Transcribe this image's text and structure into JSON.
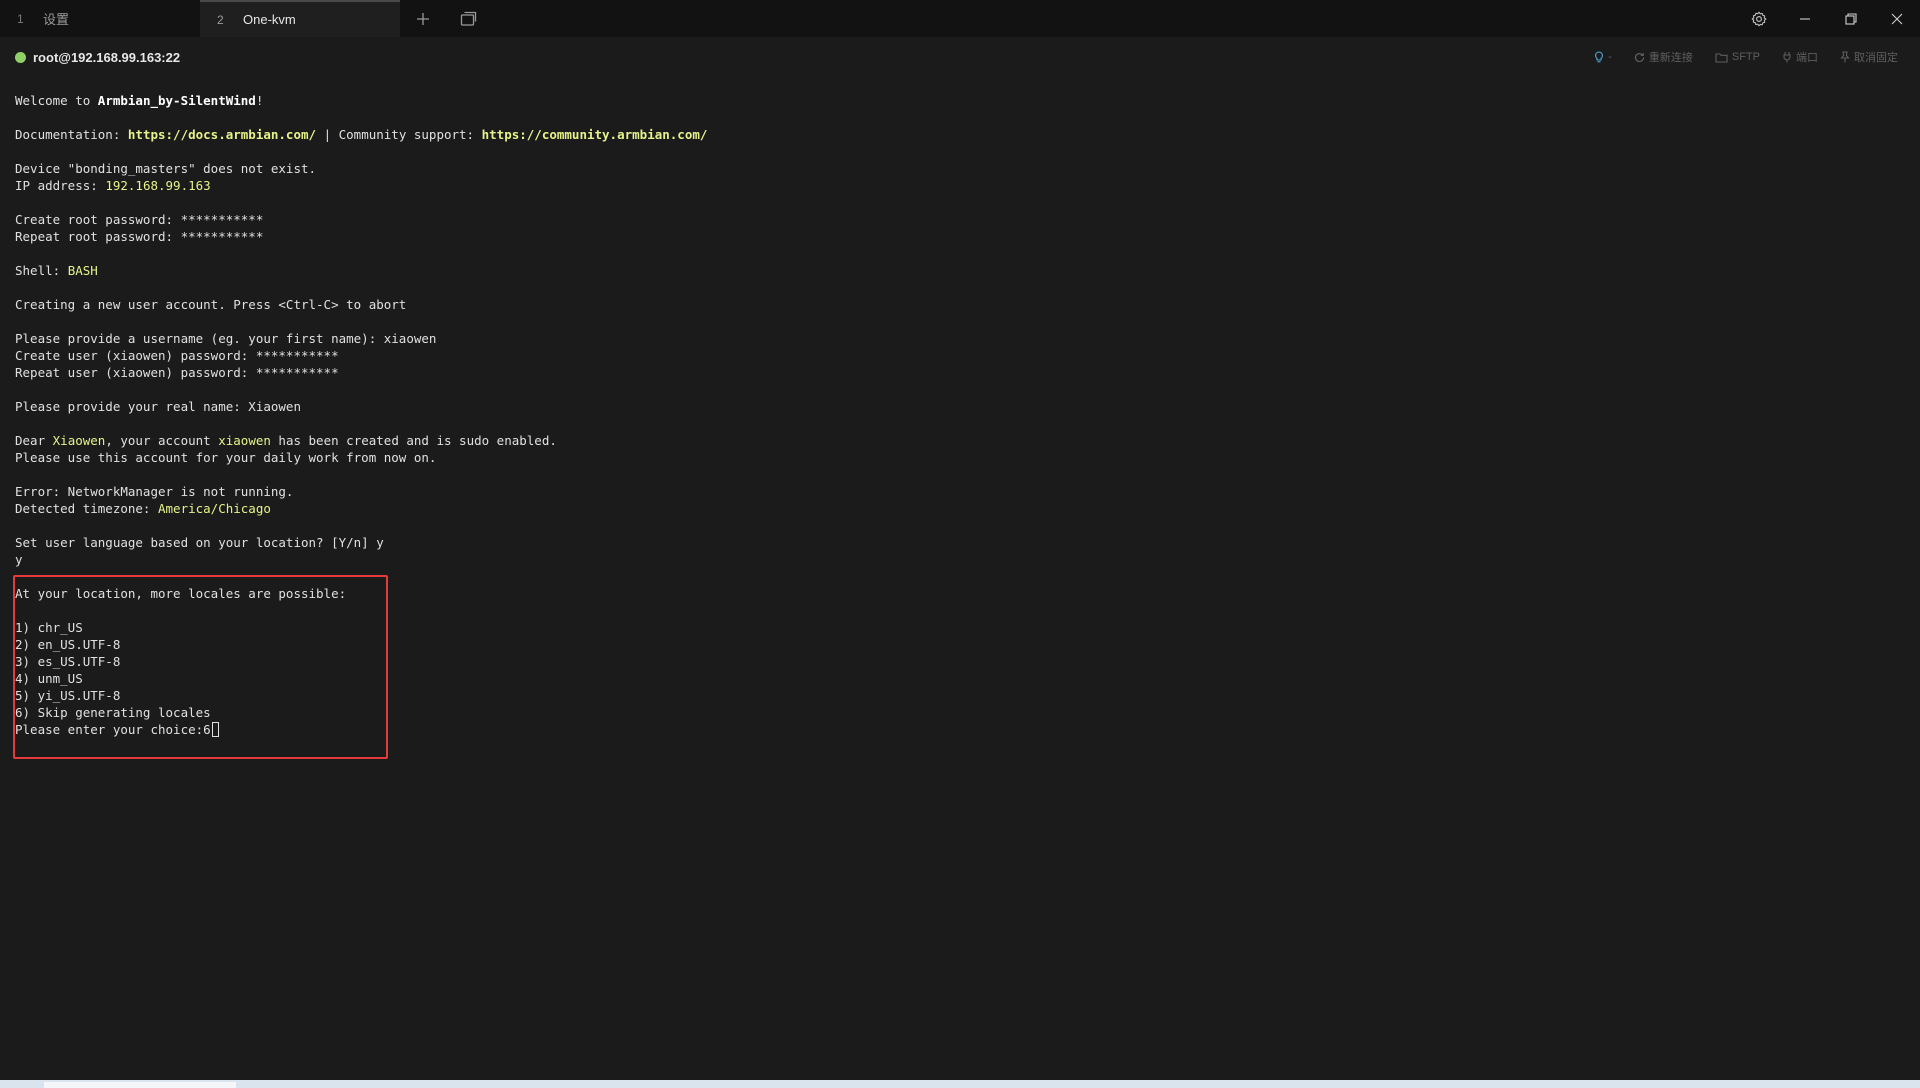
{
  "tabs": [
    {
      "index": "1",
      "label": "设置"
    },
    {
      "index": "2",
      "label": "One-kvm"
    }
  ],
  "icons": {
    "add_tab": "plus-icon",
    "tab_switcher": "windows-icon",
    "settings": "gear-icon",
    "minimize": "minimize-icon",
    "restore": "restore-icon",
    "close": "close-icon"
  },
  "colors": {
    "status_connected": "#8fd166",
    "highlight_text": "#e6f28a",
    "annotation_box": "#e33a3a"
  },
  "session": {
    "title": "root@192.168.99.163:22",
    "actions": {
      "hint": "-",
      "reconnect": "重新连接",
      "sftp": "SFTP",
      "port": "端口",
      "unpin": "取消固定"
    }
  },
  "terminal": {
    "welcome_prefix": "Welcome to ",
    "welcome_name": "Armbian_by-SilentWind",
    "welcome_suffix": "!",
    "doc_label": "Documentation: ",
    "doc_url": "https://docs.armbian.com/",
    "doc_sep": " | Community support: ",
    "community_url": "https://community.armbian.com/",
    "bonding": "Device \"bonding_masters\" does not exist.",
    "ip_label": "IP address: ",
    "ip_value": "192.168.99.163",
    "create_root": "Create root password: ***********",
    "repeat_root": "Repeat root password: ***********",
    "shell_label": "Shell: ",
    "shell_value": "BASH",
    "creating_user": "Creating a new user account. Press <Ctrl-C> to abort",
    "provide_username": "Please provide a username (eg. your first name): xiaowen",
    "create_user_pw": "Create user (xiaowen) password: ***********",
    "repeat_user_pw": "Repeat user (xiaowen) password: ***********",
    "real_name": "Please provide your real name: Xiaowen",
    "dear_prefix": "Dear ",
    "dear_name": "Xiaowen",
    "dear_mid": ", your account ",
    "dear_account": "xiaowen",
    "dear_suffix": " has been created and is sudo enabled.",
    "daily_work": "Please use this account for your daily work from now on.",
    "nm_error": "Error: NetworkManager is not running.",
    "tz_label": "Detected timezone: ",
    "tz_value": "America/Chicago",
    "set_lang": "Set user language based on your location? [Y/n] y",
    "answer_y": "y",
    "locales_intro": "At your location, more locales are possible:",
    "locales": [
      "1) chr_US",
      "2) en_US.UTF-8",
      "3) es_US.UTF-8",
      "4) unm_US",
      "5) yi_US.UTF-8",
      "6) Skip generating locales"
    ],
    "choice_prompt": "Please enter your choice:6"
  }
}
